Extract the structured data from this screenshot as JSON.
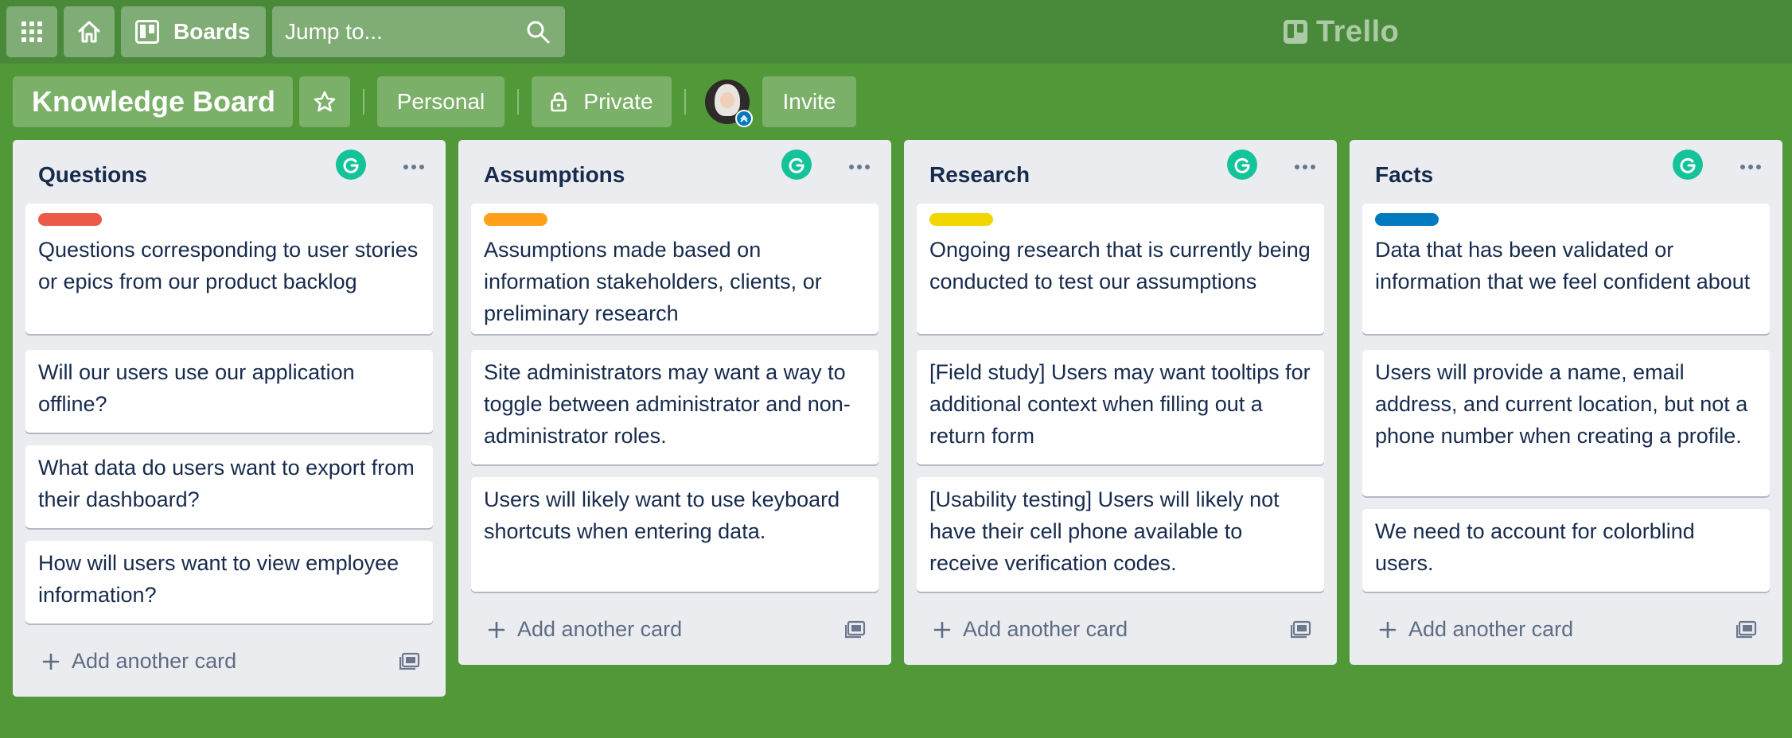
{
  "nav": {
    "boards_label": "Boards",
    "search_placeholder": "Jump to...",
    "logo": "Trello"
  },
  "board": {
    "title": "Knowledge Board",
    "visibility_team": "Personal",
    "privacy": "Private",
    "invite": "Invite"
  },
  "lists": [
    {
      "title": "Questions",
      "label_color": "#eb5a46",
      "cards": [
        "Questions corresponding to user stories or epics from our product backlog",
        "Will our users use our application offline?",
        "What data do users want to export from their dashboard?",
        "How will users want to view employee information?"
      ],
      "add": "Add another card"
    },
    {
      "title": "Assumptions",
      "label_color": "#ff9f1a",
      "cards": [
        "Assumptions made based on information stakeholders, clients, or preliminary research",
        "Site administrators may want a way to toggle between administrator and non-administrator roles.",
        "Users will likely want to use keyboard shortcuts when entering data."
      ],
      "add": "Add another card"
    },
    {
      "title": "Research",
      "label_color": "#f2d600",
      "cards": [
        "Ongoing research that is currently being conducted to test our assumptions",
        "[Field study] Users may want tooltips for additional context when filling out a return form",
        "[Usability testing] Users will likely not have their cell phone available to receive verification codes."
      ],
      "add": "Add another card"
    },
    {
      "title": "Facts",
      "label_color": "#0079bf",
      "cards": [
        "Data that has been validated or information that we feel confident about",
        "Users will provide a name, email address, and current location, but not a phone number when creating a profile.",
        "We need to account for colorblind users."
      ],
      "add": "Add another card"
    }
  ],
  "icons": {
    "apps": "grid-icon",
    "home": "home-icon",
    "boards": "board-icon",
    "search": "search-icon",
    "star": "star-icon",
    "lock": "lock-icon",
    "list_menu": "ellipsis-icon",
    "grammarly": "grammarly-icon",
    "template": "card-template-icon"
  }
}
